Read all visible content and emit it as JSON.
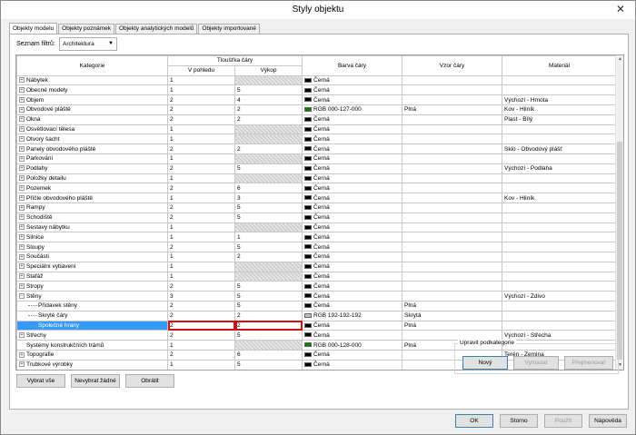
{
  "window": {
    "title": "Styly objektu",
    "close_glyph": "✕"
  },
  "tabs": [
    "Objekty modelu",
    "Objekty poznámek",
    "Objekty analytických modelů",
    "Objekty importované"
  ],
  "filter": {
    "label": "Seznam filtrů:",
    "value": "Architektura"
  },
  "grid": {
    "headers": {
      "category": "Kategorie",
      "line_weight": "Tloušťka čáry",
      "projection": "V pohledu",
      "cut": "Výkop",
      "line_color": "Barva čáry",
      "line_pattern": "Vzor čáry",
      "material": "Materiál"
    },
    "rows": [
      {
        "level": 0,
        "expander": "+",
        "name": "Nábytek",
        "proj": "1",
        "cut": "",
        "hatch": true,
        "color_hex": "#000000",
        "color": "Černá",
        "pattern": "",
        "material": ""
      },
      {
        "level": 0,
        "expander": "+",
        "name": "Obecné modely",
        "proj": "1",
        "cut": "5",
        "hatch": false,
        "color_hex": "#000000",
        "color": "Černá",
        "pattern": "",
        "material": ""
      },
      {
        "level": 0,
        "expander": "+",
        "name": "Objem",
        "proj": "2",
        "cut": "4",
        "hatch": false,
        "color_hex": "#000000",
        "color": "Černá",
        "pattern": "",
        "material": "Výchozí - Hmota"
      },
      {
        "level": 0,
        "expander": "+",
        "name": "Obvodové pláště",
        "proj": "2",
        "cut": "2",
        "hatch": false,
        "color_hex": "#007f00",
        "color": "RGB 000-127-000",
        "pattern": "Plná",
        "material": "Kov - Hliník"
      },
      {
        "level": 0,
        "expander": "+",
        "name": "Okna",
        "proj": "2",
        "cut": "2",
        "hatch": false,
        "color_hex": "#000000",
        "color": "Černá",
        "pattern": "",
        "material": "Plast - Bílý"
      },
      {
        "level": 0,
        "expander": "+",
        "name": "Osvětlovací tělesa",
        "proj": "1",
        "cut": "",
        "hatch": true,
        "color_hex": "#000000",
        "color": "Černá",
        "pattern": "",
        "material": ""
      },
      {
        "level": 0,
        "expander": "+",
        "name": "Otvory šacht",
        "proj": "1",
        "cut": "",
        "hatch": true,
        "color_hex": "#000000",
        "color": "Černá",
        "pattern": "",
        "material": ""
      },
      {
        "level": 0,
        "expander": "+",
        "name": "Panely obvodového pláště",
        "proj": "2",
        "cut": "2",
        "hatch": false,
        "color_hex": "#000000",
        "color": "Černá",
        "pattern": "",
        "material": "Sklo - Obvodový plášť"
      },
      {
        "level": 0,
        "expander": "+",
        "name": "Parkování",
        "proj": "1",
        "cut": "",
        "hatch": true,
        "color_hex": "#000000",
        "color": "Černá",
        "pattern": "",
        "material": ""
      },
      {
        "level": 0,
        "expander": "+",
        "name": "Podlahy",
        "proj": "2",
        "cut": "5",
        "hatch": false,
        "color_hex": "#000000",
        "color": "Černá",
        "pattern": "",
        "material": "Výchozí - Podlaha"
      },
      {
        "level": 0,
        "expander": "+",
        "name": "Položky detailu",
        "proj": "1",
        "cut": "",
        "hatch": true,
        "color_hex": "#000000",
        "color": "Černá",
        "pattern": "",
        "material": ""
      },
      {
        "level": 0,
        "expander": "+",
        "name": "Pozemek",
        "proj": "2",
        "cut": "6",
        "hatch": false,
        "color_hex": "#000000",
        "color": "Černá",
        "pattern": "",
        "material": ""
      },
      {
        "level": 0,
        "expander": "+",
        "name": "Příčle obvodového pláště",
        "proj": "1",
        "cut": "3",
        "hatch": false,
        "color_hex": "#000000",
        "color": "Černá",
        "pattern": "",
        "material": "Kov - Hliník"
      },
      {
        "level": 0,
        "expander": "+",
        "name": "Rampy",
        "proj": "2",
        "cut": "5",
        "hatch": false,
        "color_hex": "#000000",
        "color": "Černá",
        "pattern": "",
        "material": ""
      },
      {
        "level": 0,
        "expander": "+",
        "name": "Schodiště",
        "proj": "2",
        "cut": "5",
        "hatch": false,
        "color_hex": "#000000",
        "color": "Černá",
        "pattern": "",
        "material": ""
      },
      {
        "level": 0,
        "expander": "+",
        "name": "Sestavy nábytku",
        "proj": "1",
        "cut": "",
        "hatch": true,
        "color_hex": "#000000",
        "color": "Černá",
        "pattern": "",
        "material": ""
      },
      {
        "level": 0,
        "expander": "+",
        "name": "Silnice",
        "proj": "1",
        "cut": "1",
        "hatch": false,
        "color_hex": "#000000",
        "color": "Černá",
        "pattern": "",
        "material": ""
      },
      {
        "level": 0,
        "expander": "+",
        "name": "Sloupy",
        "proj": "2",
        "cut": "5",
        "hatch": false,
        "color_hex": "#000000",
        "color": "Černá",
        "pattern": "",
        "material": ""
      },
      {
        "level": 0,
        "expander": "+",
        "name": "Součásti",
        "proj": "1",
        "cut": "2",
        "hatch": false,
        "color_hex": "#000000",
        "color": "Černá",
        "pattern": "",
        "material": ""
      },
      {
        "level": 0,
        "expander": "+",
        "name": "Speciální vybavení",
        "proj": "1",
        "cut": "",
        "hatch": true,
        "color_hex": "#000000",
        "color": "Černá",
        "pattern": "",
        "material": ""
      },
      {
        "level": 0,
        "expander": "+",
        "name": "Stafáž",
        "proj": "1",
        "cut": "",
        "hatch": true,
        "color_hex": "#000000",
        "color": "Černá",
        "pattern": "",
        "material": ""
      },
      {
        "level": 0,
        "expander": "+",
        "name": "Stropy",
        "proj": "2",
        "cut": "5",
        "hatch": false,
        "color_hex": "#000000",
        "color": "Černá",
        "pattern": "",
        "material": ""
      },
      {
        "level": 0,
        "expander": "−",
        "name": "Stěny",
        "proj": "3",
        "cut": "5",
        "hatch": false,
        "color_hex": "#000000",
        "color": "Černá",
        "pattern": "",
        "material": "Výchozí - Zdivo"
      },
      {
        "level": 1,
        "expander": "",
        "name": "Přídavek stěny",
        "proj": "2",
        "cut": "5",
        "hatch": false,
        "color_hex": "#000000",
        "color": "Černá",
        "pattern": "Plná",
        "material": ""
      },
      {
        "level": 1,
        "expander": "",
        "name": "Skryté čáry",
        "proj": "2",
        "cut": "2",
        "hatch": false,
        "color_hex": "#c0c0c0",
        "color": "RGB 192-192-192",
        "pattern": "Skrytá",
        "material": ""
      },
      {
        "level": 1,
        "expander": "",
        "name": "Společné hrany",
        "proj": "2",
        "cut": "2",
        "hatch": false,
        "color_hex": "#000000",
        "color": "Černá",
        "pattern": "Plná",
        "material": "",
        "selected": true
      },
      {
        "level": 0,
        "expander": "+",
        "name": "Střechy",
        "proj": "2",
        "cut": "5",
        "hatch": false,
        "color_hex": "#000000",
        "color": "Černá",
        "pattern": "",
        "material": "Výchozí - Střecha"
      },
      {
        "level": 0,
        "expander": "",
        "name": "Systémy konstrukčních trámů",
        "proj": "1",
        "cut": "",
        "hatch": true,
        "color_hex": "#008000",
        "color": "RGB 000-128-000",
        "pattern": "Plná",
        "material": ""
      },
      {
        "level": 0,
        "expander": "+",
        "name": "Topografie",
        "proj": "2",
        "cut": "6",
        "hatch": false,
        "color_hex": "#000000",
        "color": "Černá",
        "pattern": "",
        "material": "Terén - Zemina"
      },
      {
        "level": 0,
        "expander": "+",
        "name": "Trubkové výrobky",
        "proj": "1",
        "cut": "5",
        "hatch": false,
        "color_hex": "#000000",
        "color": "Černá",
        "pattern": "",
        "material": ""
      }
    ]
  },
  "buttons": {
    "select_all": "Vybrat vše",
    "select_none": "Nevybrat žádné",
    "invert": "Obrátit",
    "new": "Nový",
    "delete": "Vymazat",
    "rename": "Přejmenovat",
    "ok": "OK",
    "cancel": "Storno",
    "apply": "Použít",
    "help": "Nápověda"
  },
  "subcategory_group": {
    "label": "Upravit podkategorie"
  },
  "colors": {
    "selection": "#3399ff",
    "edit_outline": "#d01010",
    "primary_border": "#3c7fb1"
  }
}
